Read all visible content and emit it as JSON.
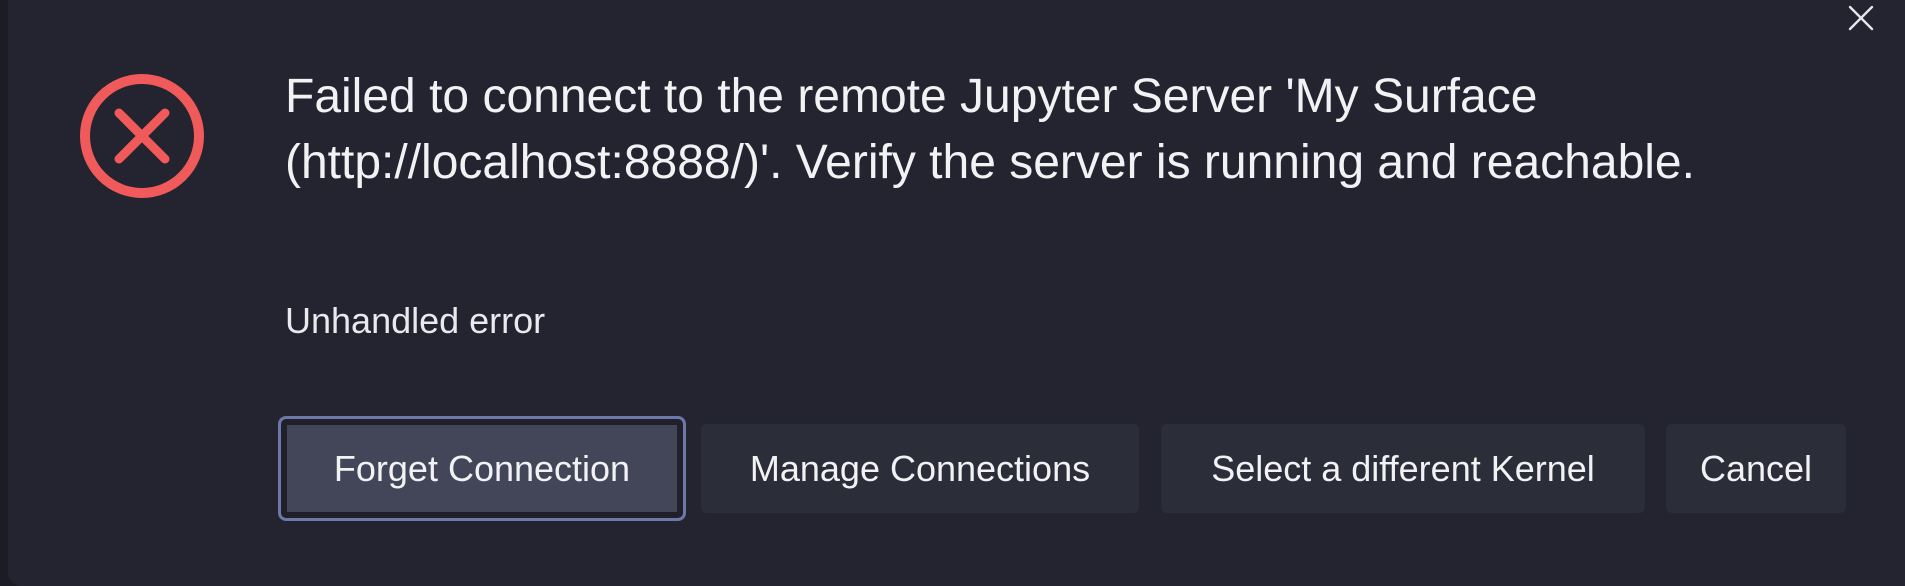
{
  "dialog": {
    "message": "Failed to connect to the remote Jupyter Server 'My Surface (http://localhost:8888/)'. Verify the server is running and reachable.",
    "detail": "Unhandled error",
    "close_icon": "close-icon",
    "status_icon": "error-circle-x-icon",
    "colors": {
      "error": "#f05a5a",
      "background": "#23242f",
      "primary_button": "#434658",
      "focus_border": "#6b78a8",
      "secondary_button": "#2b2d39"
    },
    "buttons": [
      {
        "label": "Forget Connection",
        "primary": true
      },
      {
        "label": "Manage Connections",
        "primary": false
      },
      {
        "label": "Select a different Kernel",
        "primary": false
      },
      {
        "label": "Cancel",
        "primary": false
      }
    ]
  }
}
